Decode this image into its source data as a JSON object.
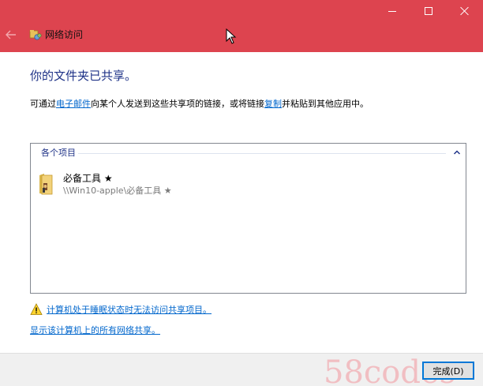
{
  "window": {
    "title": "网络访问",
    "controls": [
      "minimize",
      "maximize",
      "close"
    ],
    "accent_color": "#dd444f"
  },
  "main": {
    "heading": "你的文件夹已共享。",
    "description": {
      "part1": "可通过",
      "email_link": "电子邮件",
      "part2": "向某个人发送到这些共享项的链接，或将链接",
      "copy_link": "复制",
      "part3": "并粘贴到其他应用中。"
    },
    "list": {
      "group_header": "各个项目",
      "items": [
        {
          "name": "必备工具 ★",
          "path": "\\\\Win10-apple\\必备工具 ★",
          "icon": "folder-icon"
        }
      ]
    },
    "warning_link": "计算机处于睡眠状态时无法访问共享项目。",
    "show_shares_link": "显示该计算机上的所有网络共享。"
  },
  "footer": {
    "finish_button": "完成(D)",
    "watermark": "58codes"
  }
}
